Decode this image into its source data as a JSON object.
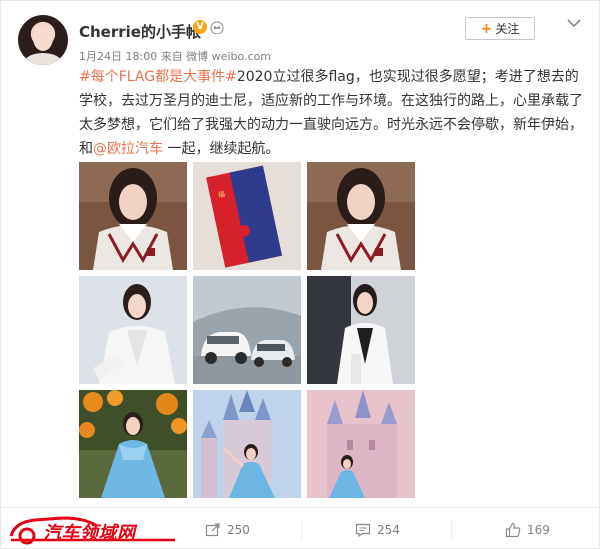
{
  "post": {
    "author": "Cherrie的小手帐",
    "verified_badge": "V",
    "meta": "1月24日 18:00 来自 微博 weibo.com",
    "follow_label": "关注",
    "follow_plus": "+",
    "text": {
      "hashtag": "#每个FLAG都是大事件#",
      "part1": "2020立过很多flag，也实现过很多愿望；考进了想去的学校，去过万圣月的迪士尼，适应新的工作与环境。在这独行的路上，心里承载了太多梦想，它们给了我强大的动力一直驶向远方。时光永远不会停歇，新年伊始，和",
      "mention": "@欧拉汽车",
      "part2": " 一起，继续起航。"
    },
    "images": [
      "portrait-in-sweater",
      "red-envelope",
      "portrait-in-sweater",
      "portrait-white-blazer",
      "white-cars",
      "portrait-white-blazer-dark",
      "halloween-disney-princess",
      "castle-princess",
      "castle-princess-pink"
    ]
  },
  "footer": {
    "watermark": "汽车领域网",
    "repost_count": "250",
    "comment_count": "254",
    "like_count": "169"
  },
  "colors": {
    "accent_orange": "#eb7350",
    "follow_plus": "#ff8200",
    "verified": "#f7a71b",
    "watermark_red": "#e60012"
  }
}
